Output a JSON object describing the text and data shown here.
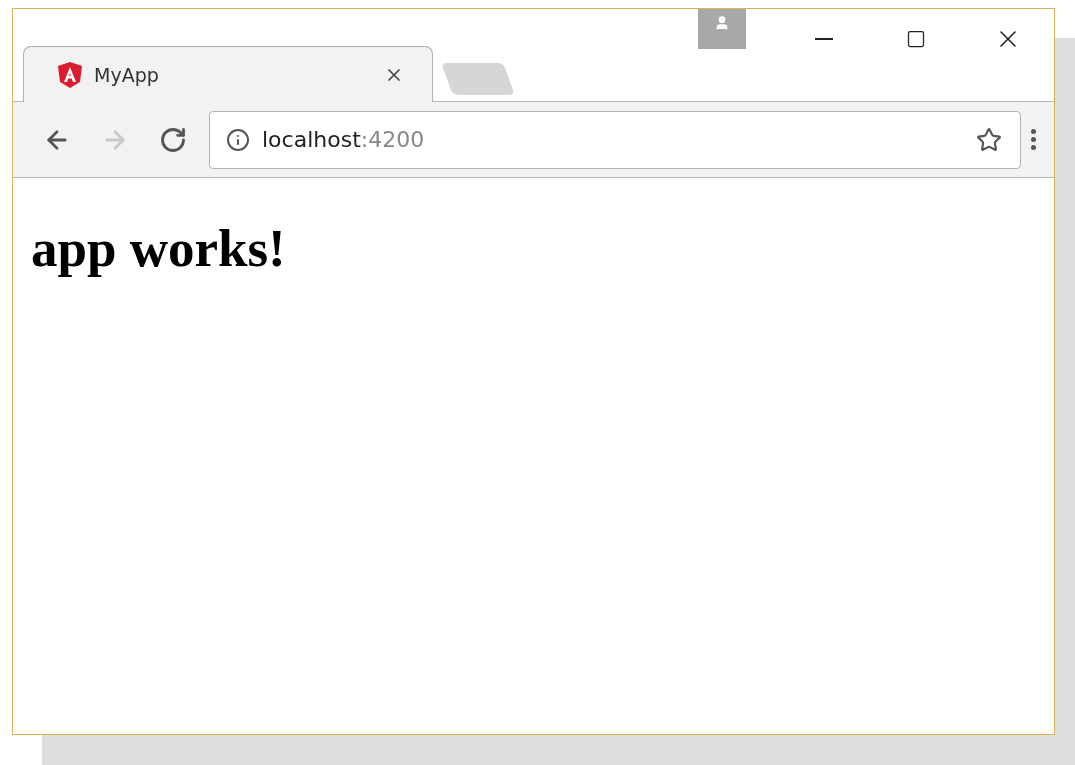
{
  "tabs": [
    {
      "title": "MyApp",
      "selected": true
    }
  ],
  "nav_buttons": [
    {
      "kind": "back",
      "disabled": false
    },
    {
      "kind": "forward",
      "disabled": true
    },
    {
      "kind": "reload",
      "disabled": false
    }
  ],
  "address": {
    "host": "localhost",
    "port": ":4200"
  },
  "page": {
    "heading": "app works!"
  }
}
